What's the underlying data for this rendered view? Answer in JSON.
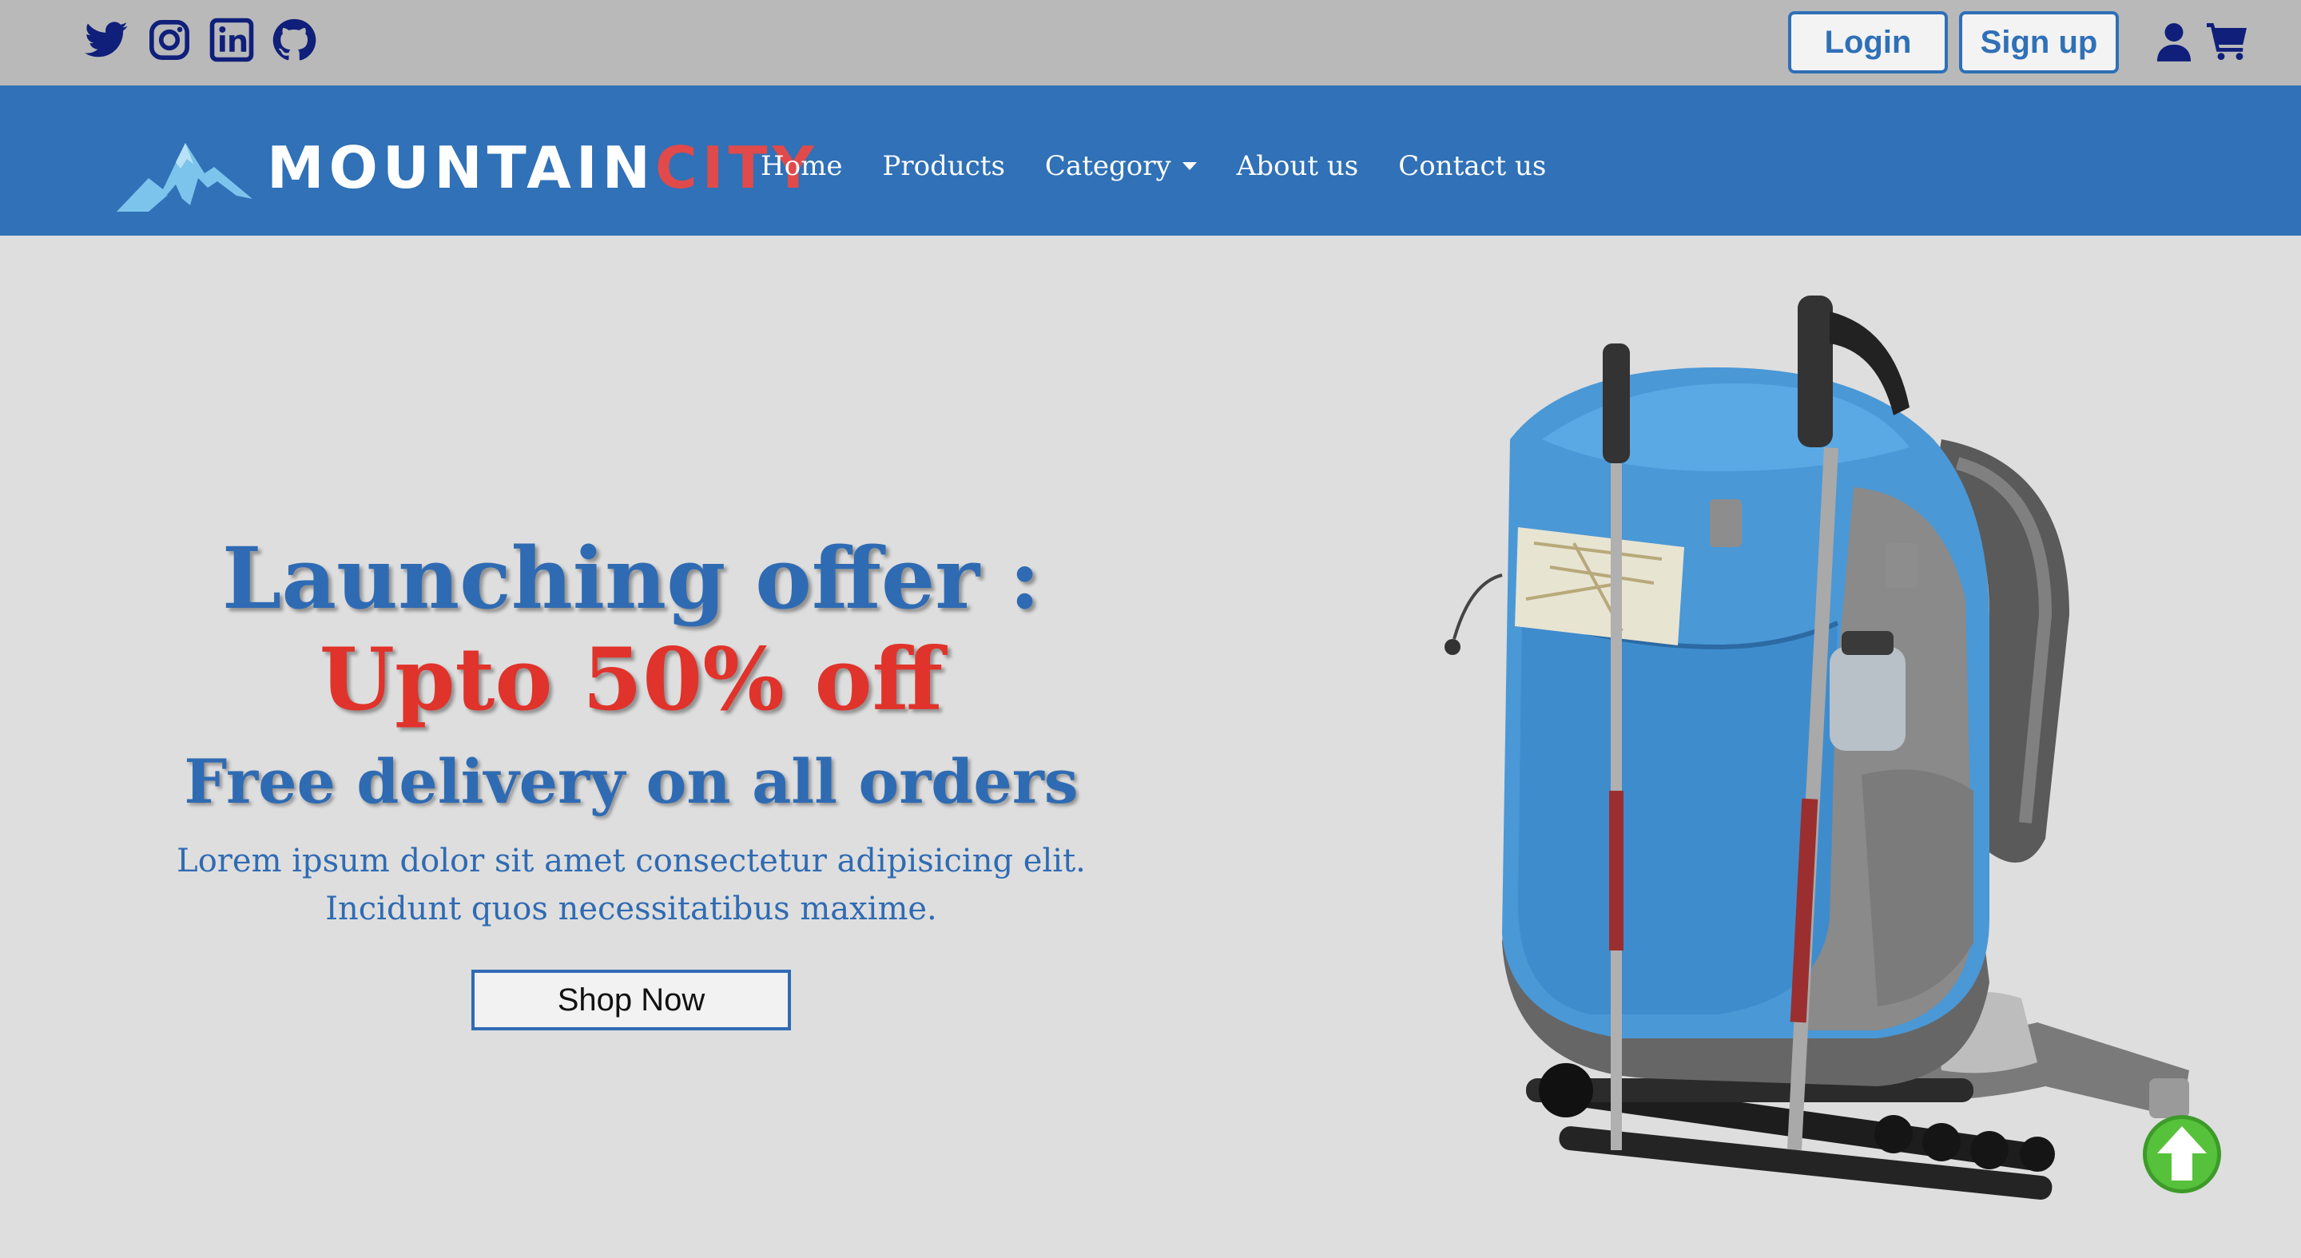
{
  "topbar": {
    "social": [
      "twitter-icon",
      "instagram-icon",
      "linkedin-icon",
      "github-icon"
    ],
    "login_label": "Login",
    "signup_label": "Sign up",
    "icons": [
      "user-icon",
      "cart-icon"
    ]
  },
  "navbar": {
    "brand_part1": "MOUNTAIN",
    "brand_part2": "CITY",
    "items": [
      {
        "label": "Home"
      },
      {
        "label": "Products"
      },
      {
        "label": "Category"
      },
      {
        "label": "About us"
      },
      {
        "label": "Contact us"
      }
    ]
  },
  "hero": {
    "line1": "Launching offer :",
    "line2": "Upto 50% off",
    "line3": "Free delivery on all orders",
    "body": "Lorem ipsum dolor sit amet consectetur adipisicing elit. Incidunt quos necessitatibus maxime.",
    "cta": "Shop Now"
  },
  "colors": {
    "topbar_bg": "#b9b9b9",
    "nav_bg": "#3071b7",
    "page_bg": "#dedede",
    "accent_blue": "#2f6bb3",
    "accent_red": "#e0332b",
    "icon_navy": "#0f1f7a"
  }
}
